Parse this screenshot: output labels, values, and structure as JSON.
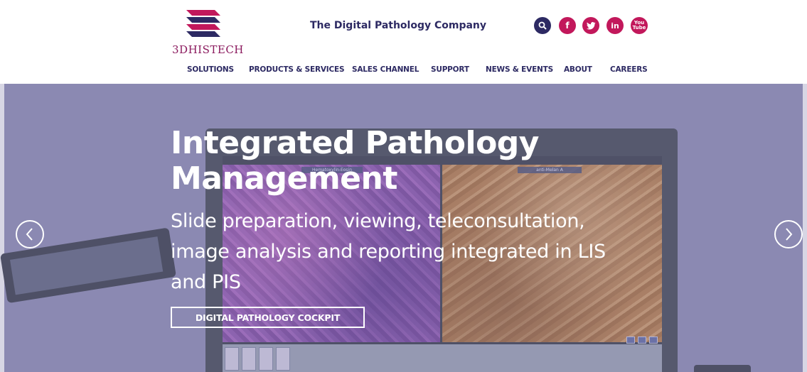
{
  "brand": {
    "logo_text_prefix": "3D",
    "logo_text_suffix": "HISTECH",
    "tagline": "The Digital Pathology Company",
    "colors": {
      "navy": "#2d2a63",
      "magenta": "#c2185b",
      "hero_bg": "#8b89b2"
    }
  },
  "header_icons": [
    {
      "name": "search-icon",
      "glyph": "search"
    },
    {
      "name": "facebook-icon",
      "glyph": "f"
    },
    {
      "name": "twitter-icon",
      "glyph": "twitter"
    },
    {
      "name": "linkedin-icon",
      "glyph": "in"
    },
    {
      "name": "youtube-icon",
      "glyph": "You Tube"
    }
  ],
  "nav": {
    "items": [
      {
        "label": "SOLUTIONS"
      },
      {
        "label": "PRODUCTS & SERVICES"
      },
      {
        "label": "SALES CHANNEL"
      },
      {
        "label": "SUPPORT"
      },
      {
        "label": "NEWS & EVENTS"
      },
      {
        "label": "ABOUT"
      },
      {
        "label": "CAREERS"
      }
    ]
  },
  "hero": {
    "title_line1": "Integrated Pathology",
    "title_line2": "Management",
    "subtitle_line1": "Slide preparation, viewing, teleconsultation,",
    "subtitle_line2": "image analysis and reporting integrated in LIS",
    "subtitle_line3": "and PIS",
    "cta_label": "DIGITAL PATHOLOGY COCKPIT",
    "panel_left_label": "Hematoxylin-Eosin",
    "panel_right_label": "anti-Melan A",
    "prev_icon": "chevron-left-icon",
    "next_icon": "chevron-right-icon"
  }
}
